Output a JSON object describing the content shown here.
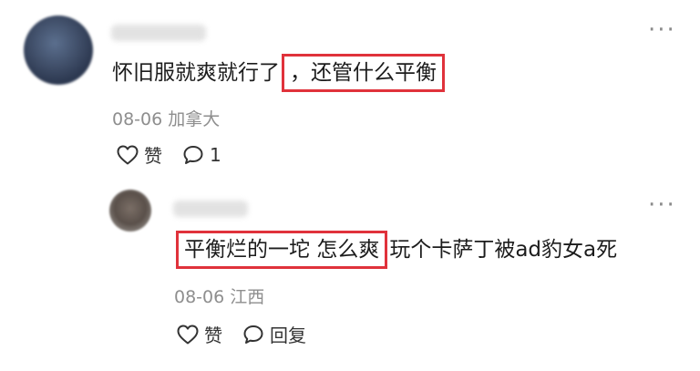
{
  "comments": [
    {
      "text_before": "怀旧服就爽就行了",
      "text_highlight": "，还管什么平衡",
      "text_after": "",
      "date": "08-06",
      "location": "加拿大",
      "like_label": "赞",
      "reply_count": "1"
    },
    {
      "text_before": "",
      "text_highlight": "平衡烂的一坨 怎么爽",
      "text_after": "玩个卡萨丁被ad豹女a死",
      "date": "08-06",
      "location": "江西",
      "like_label": "赞",
      "reply_label": "回复"
    }
  ],
  "colors": {
    "highlight_border": "#e0323b",
    "meta_text": "#8e8e8e"
  },
  "icons": {
    "like": "heart-outline-icon",
    "comment": "speech-bubble-icon",
    "more": "more-dots-icon"
  }
}
